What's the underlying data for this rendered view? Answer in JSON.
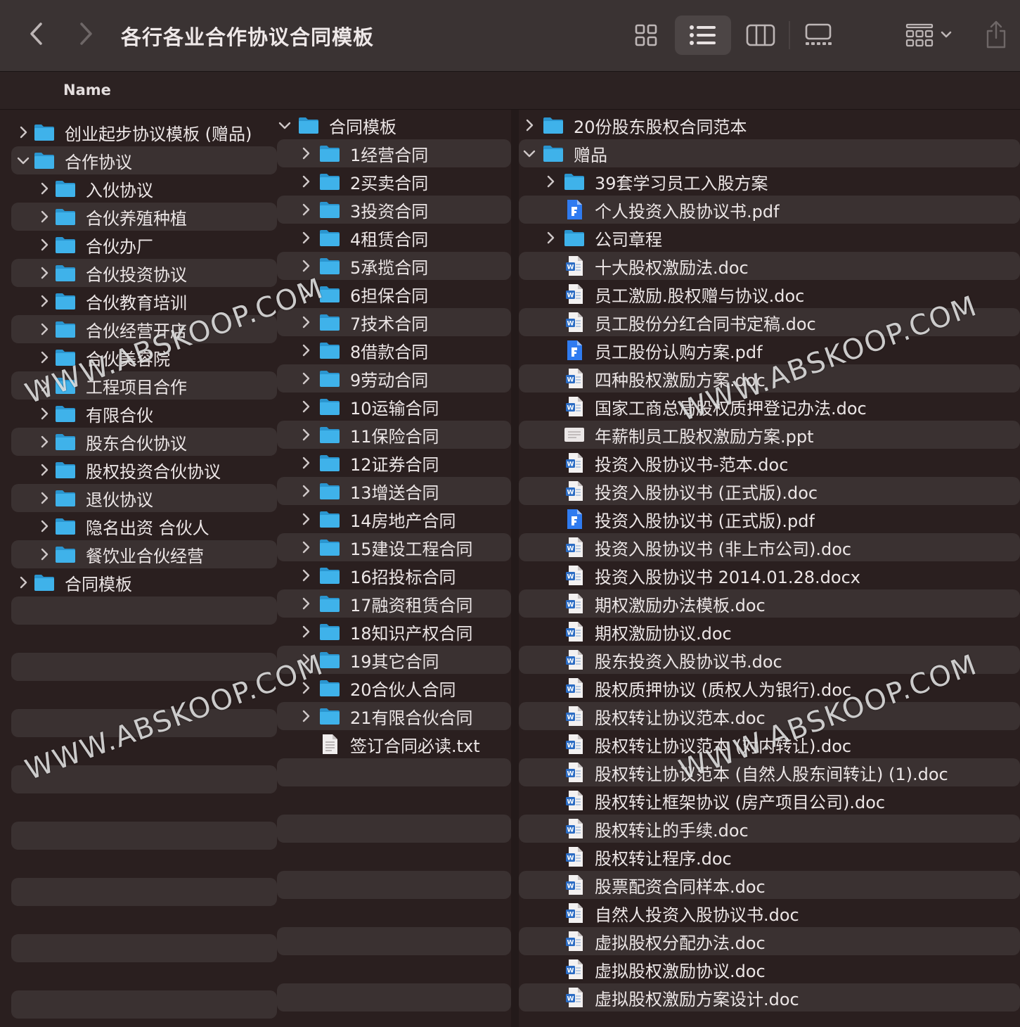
{
  "window": {
    "title": "各行各业合作协议合同模板"
  },
  "header": {
    "name_column": "Name"
  },
  "watermark": "WWW.ABSKOOP.COM",
  "toolbar_icons": [
    "chevron-left-icon",
    "chevron-right-icon",
    "grid-view-icon",
    "list-view-icon",
    "column-view-icon",
    "gallery-view-icon",
    "group-icon",
    "share-icon"
  ],
  "colors": {
    "folder": "#3fb2ea",
    "stripe": "#3a3131",
    "background": "#2a1f1f",
    "pdf": "#2f7bf0"
  },
  "column1": [
    {
      "label": "创业起步协议模板 (赠品)",
      "type": "folder",
      "level": 0,
      "state": "collapsed"
    },
    {
      "label": "合作协议",
      "type": "folder",
      "level": 0,
      "state": "expanded"
    },
    {
      "label": "入伙协议",
      "type": "folder",
      "level": 1,
      "state": "collapsed"
    },
    {
      "label": "合伙养殖种植",
      "type": "folder",
      "level": 1,
      "state": "collapsed"
    },
    {
      "label": "合伙办厂",
      "type": "folder",
      "level": 1,
      "state": "collapsed"
    },
    {
      "label": "合伙投资协议",
      "type": "folder",
      "level": 1,
      "state": "collapsed"
    },
    {
      "label": "合伙教育培训",
      "type": "folder",
      "level": 1,
      "state": "collapsed"
    },
    {
      "label": "合伙经营开店",
      "type": "folder",
      "level": 1,
      "state": "collapsed"
    },
    {
      "label": "合伙美容院",
      "type": "folder",
      "level": 1,
      "state": "collapsed"
    },
    {
      "label": "工程项目合作",
      "type": "folder",
      "level": 1,
      "state": "collapsed"
    },
    {
      "label": "有限合伙",
      "type": "folder",
      "level": 1,
      "state": "collapsed"
    },
    {
      "label": "股东合伙协议",
      "type": "folder",
      "level": 1,
      "state": "collapsed"
    },
    {
      "label": "股权投资合伙协议",
      "type": "folder",
      "level": 1,
      "state": "collapsed"
    },
    {
      "label": "退伙协议",
      "type": "folder",
      "level": 1,
      "state": "collapsed"
    },
    {
      "label": "隐名出资 合伙人",
      "type": "folder",
      "level": 1,
      "state": "collapsed"
    },
    {
      "label": "餐饮业合伙经营",
      "type": "folder",
      "level": 1,
      "state": "collapsed"
    },
    {
      "label": "合同模板",
      "type": "folder",
      "level": 0,
      "state": "collapsed"
    }
  ],
  "column2": [
    {
      "label": "合同模板",
      "type": "folder",
      "level": 0,
      "state": "expanded"
    },
    {
      "label": "1经营合同",
      "type": "folder",
      "level": 1,
      "state": "collapsed"
    },
    {
      "label": "2买卖合同",
      "type": "folder",
      "level": 1,
      "state": "collapsed"
    },
    {
      "label": "3投资合同",
      "type": "folder",
      "level": 1,
      "state": "collapsed"
    },
    {
      "label": "4租赁合同",
      "type": "folder",
      "level": 1,
      "state": "collapsed"
    },
    {
      "label": "5承揽合同",
      "type": "folder",
      "level": 1,
      "state": "collapsed"
    },
    {
      "label": "6担保合同",
      "type": "folder",
      "level": 1,
      "state": "collapsed"
    },
    {
      "label": "7技术合同",
      "type": "folder",
      "level": 1,
      "state": "collapsed"
    },
    {
      "label": "8借款合同",
      "type": "folder",
      "level": 1,
      "state": "collapsed"
    },
    {
      "label": "9劳动合同",
      "type": "folder",
      "level": 1,
      "state": "collapsed"
    },
    {
      "label": "10运输合同",
      "type": "folder",
      "level": 1,
      "state": "collapsed"
    },
    {
      "label": "11保险合同",
      "type": "folder",
      "level": 1,
      "state": "collapsed"
    },
    {
      "label": "12证券合同",
      "type": "folder",
      "level": 1,
      "state": "collapsed"
    },
    {
      "label": "13增送合同",
      "type": "folder",
      "level": 1,
      "state": "collapsed"
    },
    {
      "label": "14房地产合同",
      "type": "folder",
      "level": 1,
      "state": "collapsed"
    },
    {
      "label": "15建设工程合同",
      "type": "folder",
      "level": 1,
      "state": "collapsed"
    },
    {
      "label": "16招投标合同",
      "type": "folder",
      "level": 1,
      "state": "collapsed"
    },
    {
      "label": "17融资租赁合同",
      "type": "folder",
      "level": 1,
      "state": "collapsed"
    },
    {
      "label": "18知识产权合同",
      "type": "folder",
      "level": 1,
      "state": "collapsed"
    },
    {
      "label": "19其它合同",
      "type": "folder",
      "level": 1,
      "state": "collapsed"
    },
    {
      "label": "20合伙人合同",
      "type": "folder",
      "level": 1,
      "state": "collapsed"
    },
    {
      "label": "21有限合伙合同",
      "type": "folder",
      "level": 1,
      "state": "collapsed"
    },
    {
      "label": "签订合同必读.txt",
      "type": "txt",
      "level": 1,
      "state": "none"
    }
  ],
  "column3": [
    {
      "label": "20份股东股权合同范本",
      "type": "folder",
      "level": 0,
      "state": "collapsed"
    },
    {
      "label": "赠品",
      "type": "folder",
      "level": 0,
      "state": "expanded"
    },
    {
      "label": "39套学习员工入股方案",
      "type": "folder",
      "level": 1,
      "state": "collapsed"
    },
    {
      "label": "个人投资入股协议书.pdf",
      "type": "pdf",
      "level": 1,
      "state": "none"
    },
    {
      "label": "公司章程",
      "type": "folder",
      "level": 1,
      "state": "collapsed"
    },
    {
      "label": "十大股权激励法.doc",
      "type": "doc",
      "level": 1,
      "state": "none"
    },
    {
      "label": "员工激励.股权赠与协议.doc",
      "type": "doc",
      "level": 1,
      "state": "none"
    },
    {
      "label": "员工股份分红合同书定稿.doc",
      "type": "doc",
      "level": 1,
      "state": "none"
    },
    {
      "label": "员工股份认购方案.pdf",
      "type": "pdf",
      "level": 1,
      "state": "none"
    },
    {
      "label": "四种股权激励方案.doc",
      "type": "doc",
      "level": 1,
      "state": "none"
    },
    {
      "label": "国家工商总局股权质押登记办法.doc",
      "type": "doc",
      "level": 1,
      "state": "none"
    },
    {
      "label": "年薪制员工股权激励方案.ppt",
      "type": "ppt",
      "level": 1,
      "state": "none"
    },
    {
      "label": "投资入股协议书-范本.doc",
      "type": "doc",
      "level": 1,
      "state": "none"
    },
    {
      "label": "投资入股协议书 (正式版).doc",
      "type": "doc",
      "level": 1,
      "state": "none"
    },
    {
      "label": "投资入股协议书 (正式版).pdf",
      "type": "pdf",
      "level": 1,
      "state": "none"
    },
    {
      "label": "投资入股协议书 (非上市公司).doc",
      "type": "doc",
      "level": 1,
      "state": "none"
    },
    {
      "label": "投资入股协议书 2014.01.28.docx",
      "type": "docx",
      "level": 1,
      "state": "none"
    },
    {
      "label": "期权激励办法模板.doc",
      "type": "doc",
      "level": 1,
      "state": "none"
    },
    {
      "label": "期权激励协议.doc",
      "type": "doc",
      "level": 1,
      "state": "none"
    },
    {
      "label": "股东投资入股协议书.doc",
      "type": "doc",
      "level": 1,
      "state": "none"
    },
    {
      "label": "股权质押协议 (质权人为银行).doc",
      "type": "doc",
      "level": 1,
      "state": "none"
    },
    {
      "label": "股权转让协议范本.doc",
      "type": "doc",
      "level": 1,
      "state": "none"
    },
    {
      "label": "股权转让协议范本 (对内转让).doc",
      "type": "doc",
      "level": 1,
      "state": "none"
    },
    {
      "label": "股权转让协议范本 (自然人股东间转让) (1).doc",
      "type": "doc",
      "level": 1,
      "state": "none"
    },
    {
      "label": "股权转让框架协议 (房产项目公司).doc",
      "type": "doc",
      "level": 1,
      "state": "none"
    },
    {
      "label": "股权转让的手续.doc",
      "type": "doc",
      "level": 1,
      "state": "none"
    },
    {
      "label": "股权转让程序.doc",
      "type": "doc",
      "level": 1,
      "state": "none"
    },
    {
      "label": "股票配资合同样本.doc",
      "type": "doc",
      "level": 1,
      "state": "none"
    },
    {
      "label": "自然人投资入股协议书.doc",
      "type": "doc",
      "level": 1,
      "state": "none"
    },
    {
      "label": "虚拟股权分配办法.doc",
      "type": "doc",
      "level": 1,
      "state": "none"
    },
    {
      "label": "虚拟股权激励协议.doc",
      "type": "doc",
      "level": 1,
      "state": "none"
    },
    {
      "label": "虚拟股权激励方案设计.doc",
      "type": "doc",
      "level": 1,
      "state": "none"
    }
  ]
}
